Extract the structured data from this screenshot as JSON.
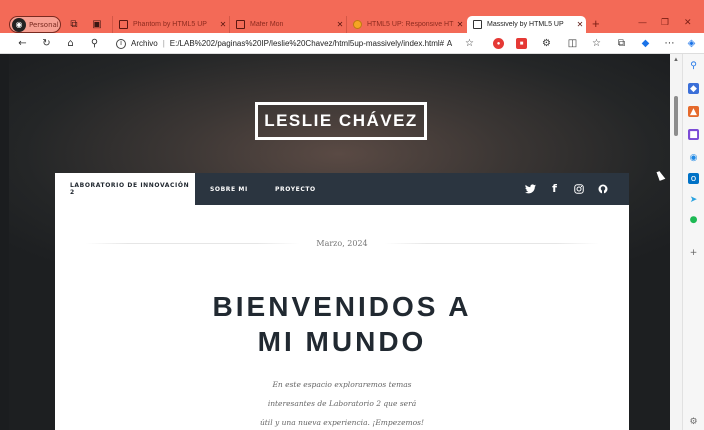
{
  "browser": {
    "profile_label": "Personal",
    "tabs": [
      {
        "title": "Phantom by HTML5 UP"
      },
      {
        "title": "Mafer Mon"
      },
      {
        "title": "HTML5 UP: Responsive HTML..."
      },
      {
        "title": "Massively by HTML5 UP"
      }
    ],
    "address_security": "Archivo",
    "address_url": "E:/LAB%202/paginas%20IP/leslie%20Chavez/html5up-massively/index.html#",
    "read_aloud": "A",
    "accent_color": "#f36a57"
  },
  "site": {
    "logo": "LESLIE CHÁVEZ",
    "nav": {
      "active": "LABORATORIO DE INNOVACIÓN 2",
      "items": [
        "SOBRE MI",
        "PROYECTO"
      ]
    },
    "post": {
      "date": "Marzo, 2024",
      "title_line1": "BIENVENIDOS A",
      "title_line2": "MI MUNDO",
      "intro_line1": "En este espacio exploraremos temas",
      "intro_line2": "interesantes de Laboratorio 2 que será",
      "intro_line3": "útil y una nueva experiencia. ¡Empezemos!"
    }
  }
}
